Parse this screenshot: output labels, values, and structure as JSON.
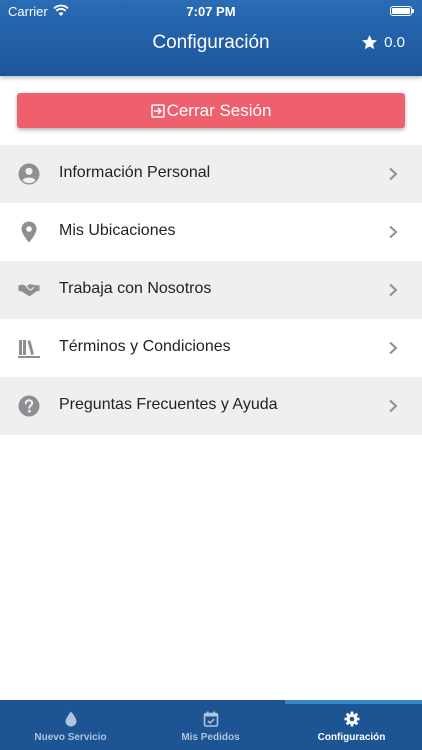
{
  "status_bar": {
    "carrier": "Carrier",
    "time": "7:07 PM"
  },
  "header": {
    "title": "Configuración",
    "rating": "0.0"
  },
  "logout_button": {
    "label": "Cerrar Sesión"
  },
  "menu": {
    "items": [
      {
        "label": "Información Personal",
        "icon": "user-circle-icon"
      },
      {
        "label": "Mis Ubicaciones",
        "icon": "map-pin-icon"
      },
      {
        "label": "Trabaja con Nosotros",
        "icon": "handshake-icon"
      },
      {
        "label": "Términos y Condiciones",
        "icon": "books-icon"
      },
      {
        "label": "Preguntas Frecuentes y Ayuda",
        "icon": "question-circle-icon"
      }
    ]
  },
  "tabbar": {
    "tabs": [
      {
        "label": "Nuevo Servicio",
        "icon": "water-drop-icon"
      },
      {
        "label": "Mis Pedidos",
        "icon": "calendar-check-icon"
      },
      {
        "label": "Configuración",
        "icon": "gear-icon"
      }
    ],
    "active_index": 2
  },
  "colors": {
    "header": "#1b559a",
    "logout": "#f05f6d",
    "tabbar": "#1c5494",
    "menu_shade": "#efefef",
    "icon_gray": "#8e8e93"
  }
}
